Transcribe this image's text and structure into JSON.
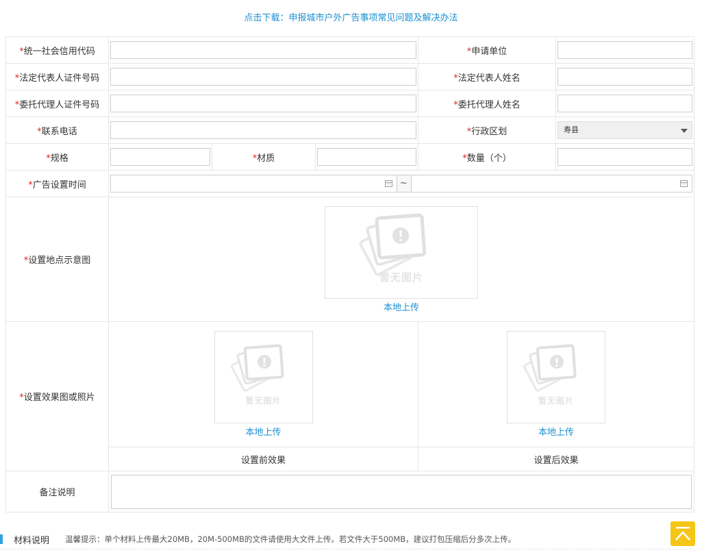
{
  "header": {
    "download_link": "点击下载：申报城市户外广告事项常见问题及解决办法"
  },
  "form": {
    "required_mark": "*",
    "credit_code_label": "统一社会信用代码",
    "applicant_label": "申请单位",
    "legal_id_label": "法定代表人证件号码",
    "legal_name_label": "法定代表人姓名",
    "agent_id_label": "委托代理人证件号码",
    "agent_name_label": "委托代理人姓名",
    "phone_label": "联系电话",
    "district_label": "行政区划",
    "district_value": "寿县",
    "spec_label": "规格",
    "material_label": "材质",
    "quantity_label": "数量（个）",
    "ad_time_label": "广告设置时间",
    "time_separator": "~",
    "site_map_label": "设置地点示意图",
    "effect_label": "设置效果图或照片",
    "no_image_text": "暂无图片",
    "upload_label": "本地上传",
    "before_effect_label": "设置前效果",
    "after_effect_label": "设置后效果",
    "remark_label": "备注说明"
  },
  "materials": {
    "title": "材料说明",
    "hint": "温馨提示：单个材料上传最大20MB，20M-500MB的文件请使用大文件上传。若文件大于500MB，建议打包压缩后分多次上传。"
  },
  "colors": {
    "accent": "#1a8fd1",
    "required": "#e02020",
    "back_to_top": "#f5c518"
  },
  "icons": [
    "calendar-icon",
    "dropdown-arrow-icon",
    "no-image-icon",
    "back-to-top-icon"
  ]
}
